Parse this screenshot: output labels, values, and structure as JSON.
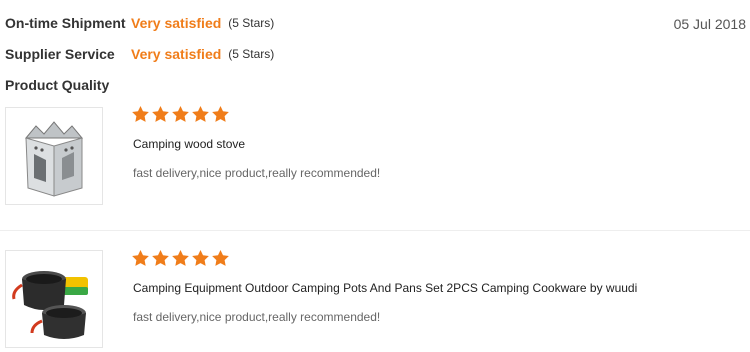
{
  "feedback": {
    "rows": [
      {
        "label": "On-time Shipment",
        "value": "Very satisfied",
        "stars": "(5 Stars)"
      },
      {
        "label": "Supplier Service",
        "value": "Very satisfied",
        "stars": "(5 Stars)"
      },
      {
        "label": "Product Quality"
      }
    ],
    "date": "05 Jul 2018"
  },
  "reviews": [
    {
      "rating": 5,
      "title": "Camping wood stove",
      "comment": "fast delivery,nice product,really recommended!",
      "thumb_icon": "wood-stove-product-image"
    },
    {
      "rating": 5,
      "title": "Camping Equipment Outdoor Camping Pots And Pans Set 2PCS Camping Cookware by wuudi",
      "comment": "fast delivery,nice product,really recommended!",
      "thumb_icon": "cookware-set-product-image"
    }
  ],
  "colors": {
    "accent": "#f07d1a",
    "star": "#f07d1a"
  }
}
